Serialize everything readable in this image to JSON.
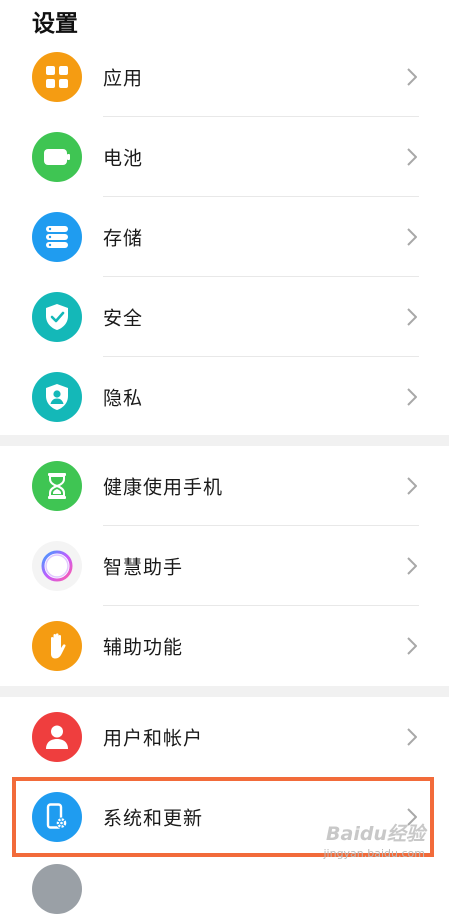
{
  "header": {
    "title": "设置"
  },
  "items": [
    {
      "label": "应用",
      "icon": "apps-icon",
      "color": "#f59c12"
    },
    {
      "label": "电池",
      "icon": "battery-icon",
      "color": "#3fc553"
    },
    {
      "label": "存储",
      "icon": "storage-icon",
      "color": "#1f9cf0"
    },
    {
      "label": "安全",
      "icon": "shield-icon",
      "color": "#14b8b8"
    },
    {
      "label": "隐私",
      "icon": "privacy-icon",
      "color": "#14b8b8"
    },
    {
      "label": "健康使用手机",
      "icon": "hourglass-icon",
      "color": "#3fc553"
    },
    {
      "label": "智慧助手",
      "icon": "assistant-icon",
      "color": "#f4f4f4"
    },
    {
      "label": "辅助功能",
      "icon": "hand-icon",
      "color": "#f59c12"
    },
    {
      "label": "用户和帐户",
      "icon": "user-icon",
      "color": "#ef3e3e"
    },
    {
      "label": "系统和更新",
      "icon": "system-update-icon",
      "color": "#1f9cf0"
    }
  ],
  "colors": {
    "highlight": "#f26b3a",
    "separator": "#f1f1f1"
  },
  "watermark": {
    "brand": "Baidu经验",
    "url": "jingyan.baidu.com"
  }
}
